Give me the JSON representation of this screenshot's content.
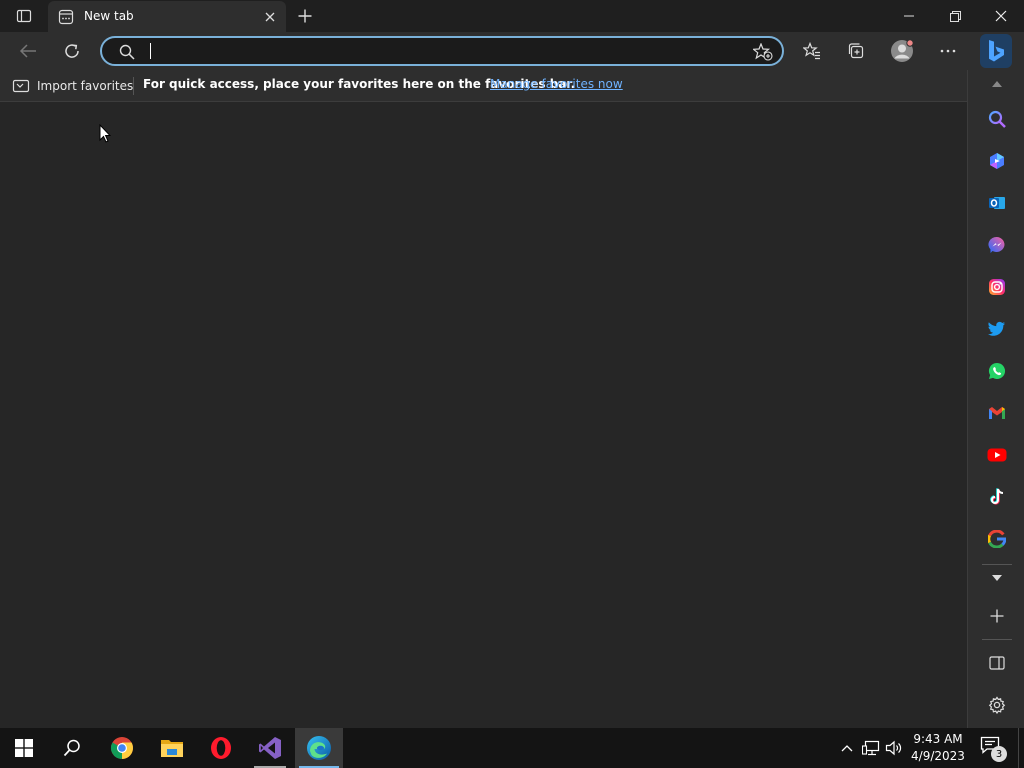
{
  "tab": {
    "title": "New tab"
  },
  "address_bar": {
    "value": "",
    "placeholder": ""
  },
  "favorites_bar": {
    "import_label": "Import favorites",
    "message": "For quick access, place your favorites here on the favorites bar.",
    "manage_link": "Manage favorites now"
  },
  "sidebar": {
    "items": [
      "search-icon",
      "copilot-icon",
      "outlook-icon",
      "messenger-icon",
      "instagram-icon",
      "twitter-icon",
      "whatsapp-icon",
      "gmail-icon",
      "youtube-icon",
      "tiktok-icon",
      "google-icon"
    ]
  },
  "taskbar": {
    "apps": [
      "start",
      "search",
      "chrome",
      "file-explorer",
      "opera",
      "visual-studio",
      "edge"
    ],
    "clock": {
      "time": "9:43 AM",
      "date": "4/9/2023"
    },
    "notification_count": "3"
  },
  "colors": {
    "accent": "#7ab1d9",
    "link": "#6fb3ff",
    "content_bg": "#262626"
  }
}
